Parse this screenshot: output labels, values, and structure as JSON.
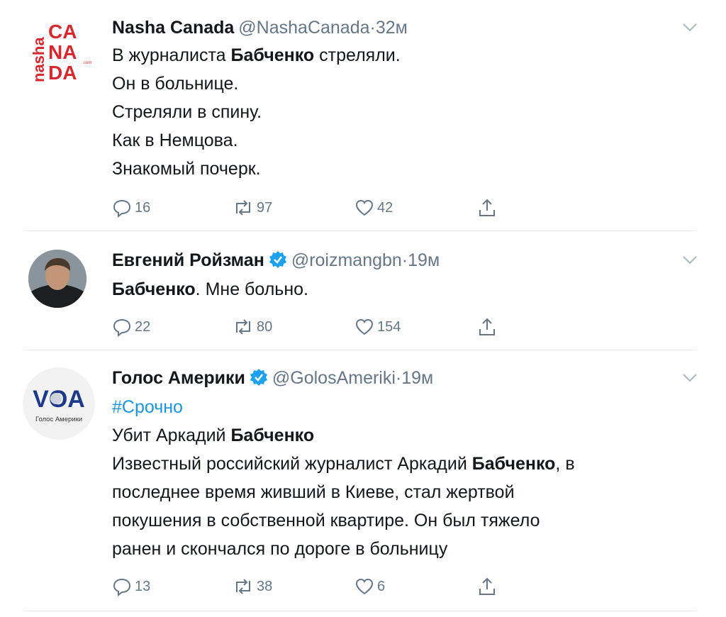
{
  "tweets": [
    {
      "name": "Nasha Canada",
      "handle": "@NashaCanada",
      "separator": "·",
      "time": "32м",
      "verified": false,
      "avatar": {
        "side_text": "nasha",
        "letters": [
          "CA",
          "NA",
          "DA"
        ],
        "small": "com"
      },
      "lines": [
        [
          {
            "t": "В журналиста "
          },
          {
            "t": "Бабченко",
            "b": true
          },
          {
            "t": " стреляли."
          }
        ],
        [
          {
            "t": "Он в больнице."
          }
        ],
        [
          {
            "t": "Стреляли в спину."
          }
        ],
        [
          {
            "t": "Как в Немцова."
          }
        ],
        [
          {
            "t": "Знакомый почерк."
          }
        ]
      ],
      "stats": {
        "replies": "16",
        "retweets": "97",
        "likes": "42"
      }
    },
    {
      "name": "Евгений Ройзман",
      "handle": "@roizmangbn",
      "separator": "·",
      "time": "19м",
      "verified": true,
      "lines": [
        [
          {
            "t": "Бабченко",
            "b": true
          },
          {
            "t": ". Мне больно."
          }
        ]
      ],
      "stats": {
        "replies": "22",
        "retweets": "80",
        "likes": "154"
      }
    },
    {
      "name": "Голос Америки",
      "handle": "@GolosAmeriki",
      "separator": "·",
      "time": "19м",
      "verified": true,
      "avatar": {
        "logo": "VOA",
        "caption": "Голос Америки"
      },
      "lines": [
        [
          {
            "t": "#Срочно",
            "link": true
          }
        ],
        [
          {
            "t": "Убит Аркадий "
          },
          {
            "t": "Бабченко",
            "b": true
          }
        ],
        [
          {
            "t": "Известный российский журналист Аркадий "
          },
          {
            "t": "Бабченко",
            "b": true
          },
          {
            "t": ", в"
          }
        ],
        [
          {
            "t": "последнее время живший в Киеве, стал жертвой"
          }
        ],
        [
          {
            "t": "покушения в собственной квартире. Он был тяжело"
          }
        ],
        [
          {
            "t": "ранен и скончался по дороге в больницу"
          }
        ]
      ],
      "stats": {
        "replies": "13",
        "retweets": "38",
        "likes": "6"
      }
    }
  ],
  "colors": {
    "text": "#14171a",
    "secondary": "#657786",
    "link": "#1b95e0",
    "verified": "#1da1f2",
    "divider": "#e6ecf0",
    "brand_red": "#d7282f"
  }
}
